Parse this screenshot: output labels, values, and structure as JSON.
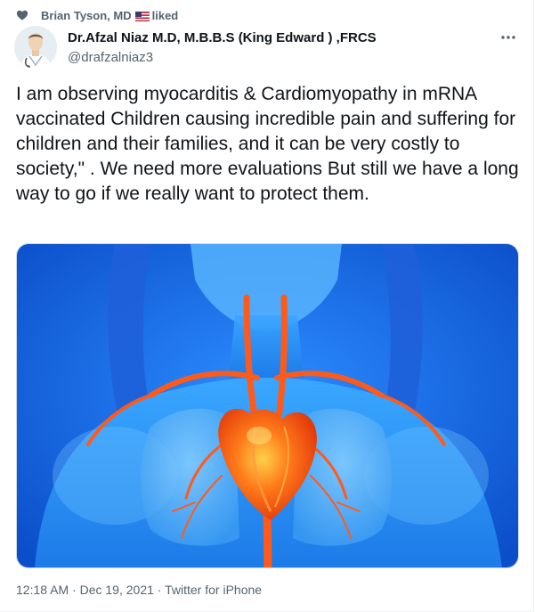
{
  "social_context": {
    "liker_name": "Brian Tyson, MD",
    "action": "liked",
    "flag_icon": "us-flag-icon",
    "heart_icon": "heart-icon"
  },
  "author": {
    "display_name": "Dr.Afzal Niaz M.D, M.B.B.S (King Edward ) ,FRCS",
    "handle": "@drafzalniaz3"
  },
  "tweet": {
    "text": "I am observing myocarditis & Cardiomyopathy in mRNA vaccinated Children causing incredible pain and suffering for children and their families, and it can be very costly to society,\" . We need more evaluations But still we have a long way to go if we really want to protect them."
  },
  "meta": {
    "time": "12:18 AM",
    "separator": "·",
    "date": "Dec 19, 2021",
    "source": "Twitter for iPhone"
  },
  "colors": {
    "secondary_text": "#536471",
    "media_background": "#1a6fe0",
    "heart_artery": "#ff5a1a"
  }
}
